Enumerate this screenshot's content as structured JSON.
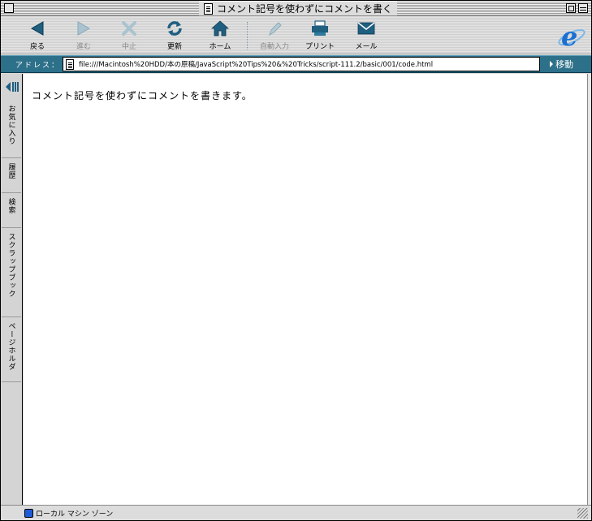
{
  "window": {
    "title": "コメント記号を使わずにコメントを書く"
  },
  "toolbar": {
    "buttons": [
      {
        "label": "戻る",
        "icon": "back-arrow-icon",
        "enabled": true
      },
      {
        "label": "進む",
        "icon": "forward-arrow-icon",
        "enabled": false
      },
      {
        "label": "中止",
        "icon": "stop-x-icon",
        "enabled": false
      },
      {
        "label": "更新",
        "icon": "refresh-icon",
        "enabled": true
      },
      {
        "label": "ホーム",
        "icon": "home-icon",
        "enabled": true
      },
      {
        "label": "自動入力",
        "icon": "autofill-pen-icon",
        "enabled": false
      },
      {
        "label": "プリント",
        "icon": "printer-icon",
        "enabled": true
      },
      {
        "label": "メール",
        "icon": "mail-icon",
        "enabled": true
      }
    ],
    "logo_icon": "internet-explorer-logo-icon"
  },
  "address": {
    "label": "アドレス：",
    "url": "file:///Macintosh%20HDD/本の原稿/JavaScript%20Tips%20&%20Tricks/script-111.2/basic/001/code.html",
    "go_label": "移動"
  },
  "sidebar": {
    "tabs": [
      "お気に入り",
      "履歴",
      "検索",
      "スクラップブック",
      "ページホルダ"
    ]
  },
  "content": {
    "text": "コメント記号を使わずにコメントを書きます。"
  },
  "status": {
    "zone": "ローカル マシン ゾーン"
  },
  "colors": {
    "accent": "#2d7089",
    "icon_blue": "#1f5f80",
    "ie_blue": "#1a6fd1"
  }
}
